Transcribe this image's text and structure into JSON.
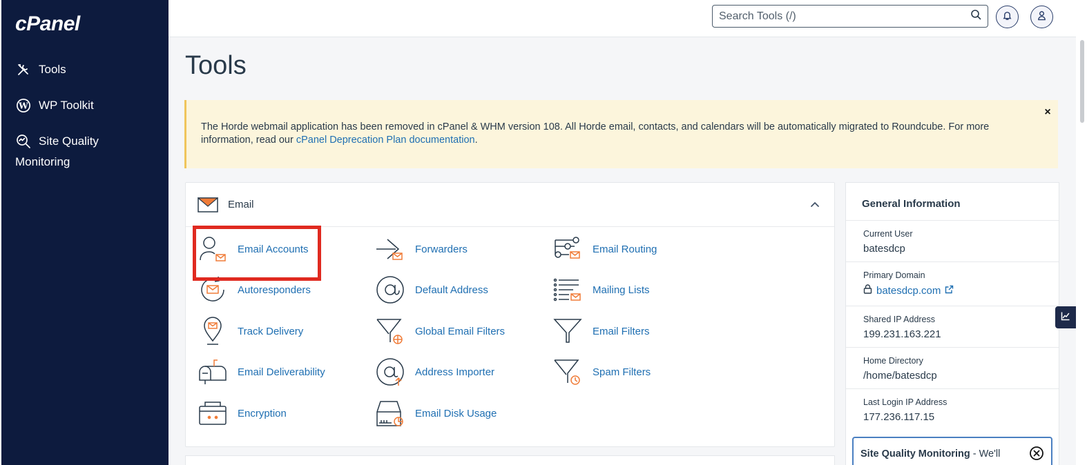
{
  "brand": {
    "logo_text": "cPanel"
  },
  "sidebar": {
    "items": [
      {
        "label": "Tools",
        "icon": "tools-icon"
      },
      {
        "label": "WP Toolkit",
        "icon": "wordpress-icon"
      },
      {
        "label_line1": "Site Quality",
        "label_line2": "Monitoring",
        "icon": "site-quality-icon"
      }
    ]
  },
  "header": {
    "search_placeholder": "Search Tools (/)",
    "notifications_icon": "bell-icon",
    "user_icon": "user-icon"
  },
  "page": {
    "title": "Tools"
  },
  "notice": {
    "text": "The Horde webmail application has been removed in cPanel & WHM version 108. All Horde email, contacts, and calendars will be automatically migrated to Roundcube. For more information, read our ",
    "link_text": "cPanel Deprecation Plan documentation",
    "suffix": ".",
    "close_label": "×"
  },
  "email_section": {
    "title": "Email",
    "tools": [
      {
        "label": "Email Accounts",
        "icon": "email-accounts-icon"
      },
      {
        "label": "Forwarders",
        "icon": "forwarders-icon"
      },
      {
        "label": "Email Routing",
        "icon": "email-routing-icon"
      },
      {
        "label": "Autoresponders",
        "icon": "autoresponders-icon"
      },
      {
        "label": "Default Address",
        "icon": "default-address-icon"
      },
      {
        "label": "Mailing Lists",
        "icon": "mailing-lists-icon"
      },
      {
        "label": "Track Delivery",
        "icon": "track-delivery-icon"
      },
      {
        "label": "Global Email Filters",
        "icon": "global-email-filters-icon"
      },
      {
        "label": "Email Filters",
        "icon": "email-filters-icon"
      },
      {
        "label": "Email Deliverability",
        "icon": "email-deliverability-icon"
      },
      {
        "label": "Address Importer",
        "icon": "address-importer-icon"
      },
      {
        "label": "Spam Filters",
        "icon": "spam-filters-icon"
      },
      {
        "label": "Encryption",
        "icon": "encryption-icon"
      },
      {
        "label": "Email Disk Usage",
        "icon": "email-disk-usage-icon"
      }
    ]
  },
  "general_info": {
    "title": "General Information",
    "rows": [
      {
        "label": "Current User",
        "value": "batesdcp"
      },
      {
        "label": "Primary Domain",
        "value": "batesdcp.com"
      },
      {
        "label": "Shared IP Address",
        "value": "199.231.163.221"
      },
      {
        "label": "Home Directory",
        "value": "/home/batesdcp"
      },
      {
        "label": "Last Login IP Address",
        "value": "177.236.117.15"
      }
    ]
  },
  "site_quality_banner": {
    "bold": "Site Quality Monitoring",
    "rest": " - We'll"
  },
  "colors": {
    "sidebar_bg": "#0d1b3e",
    "accent_orange": "#f07c38",
    "link_blue": "#1f6fb2",
    "highlight_red": "#e02a20",
    "notice_bg": "#fcf5dc"
  }
}
